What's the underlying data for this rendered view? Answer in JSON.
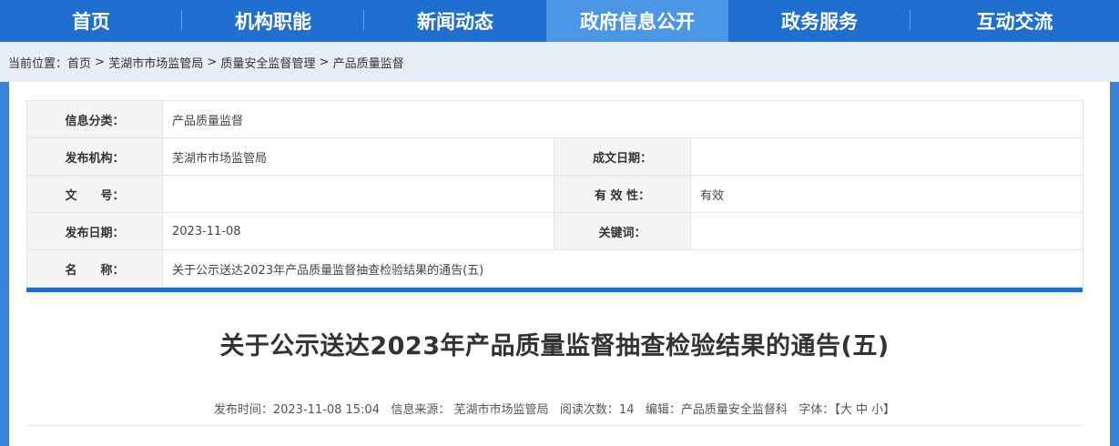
{
  "nav": {
    "items": [
      {
        "label": "首页"
      },
      {
        "label": "机构职能"
      },
      {
        "label": "新闻动态"
      },
      {
        "label": "政府信息公开"
      },
      {
        "label": "政务服务"
      },
      {
        "label": "互动交流"
      }
    ],
    "active_index": 3
  },
  "breadcrumb": {
    "prefix": "当前位置：",
    "items": [
      "首页",
      "芜湖市市场监管局",
      "质量安全监督管理",
      "产品质量监督"
    ],
    "separator": " > "
  },
  "meta": {
    "category_label": "信息分类：",
    "category_value": "产品质量监督",
    "publisher_label": "发布机构：",
    "publisher_value": "芜湖市市场监管局",
    "written_date_label": "成文日期：",
    "written_date_value": "",
    "doc_no_label": "文　　号：",
    "doc_no_value": "",
    "validity_label": "有 效 性：",
    "validity_value": "有效",
    "publish_date_label": "发布日期：",
    "publish_date_value": "2023-11-08",
    "keywords_label": "关键词：",
    "keywords_value": "",
    "name_label": "名　　称：",
    "name_value": "关于公示送达2023年产品质量监督抽查检验结果的通告(五)"
  },
  "article": {
    "title": "关于公示送达2023年产品质量监督抽查检验结果的通告(五)",
    "publish_time": "发布时间：2023-11-08 15:04",
    "source": "信息来源： 芜湖市市场监管局",
    "views": "阅读次数：14",
    "editor": "编辑：产品质量安全监督科",
    "font_label": "字体：",
    "font_open": "【",
    "font_large": "大",
    "font_medium": "中",
    "font_small": "小",
    "font_close": "】"
  },
  "colors": {
    "nav_bg": "#1f6fd0",
    "nav_active": "#4b97e6",
    "page_bg": "#3b82d6",
    "breadcrumb_bg": "#e6edf6",
    "accent_bar": "#1f6fd0"
  }
}
